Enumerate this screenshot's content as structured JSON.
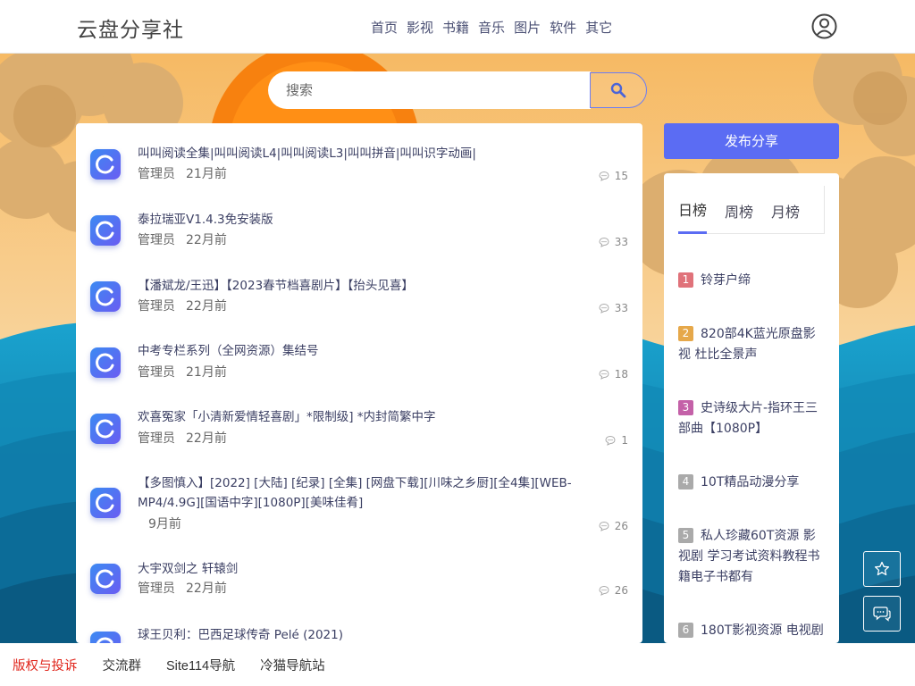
{
  "site": {
    "title": "云盘分享社"
  },
  "nav": [
    "首页",
    "影视",
    "书籍",
    "音乐",
    "图片",
    "软件",
    "其它"
  ],
  "search": {
    "placeholder": "搜索"
  },
  "posts": [
    {
      "title": "叫叫阅读全集|叫叫阅读L4|叫叫阅读L3|叫叫拼音|叫叫识字动画|",
      "author": "管理员",
      "time": "21月前",
      "comments": "15"
    },
    {
      "title": "泰拉瑞亚V1.4.3免安装版",
      "author": "管理员",
      "time": "22月前",
      "comments": "33"
    },
    {
      "title": "【潘斌龙/王迅】【2023春节档喜剧片】【抬头见喜】",
      "author": "管理员",
      "time": "22月前",
      "comments": "33"
    },
    {
      "title": "中考专栏系列（全网资源）集结号",
      "author": "管理员",
      "time": "21月前",
      "comments": "18"
    },
    {
      "title": "欢喜冤家「小清新爱情轻喜剧」*限制级] *内封简繁中字",
      "author": "管理员",
      "time": "22月前",
      "comments": "1"
    },
    {
      "title": "【多图慎入】[2022] [大陆] [纪录] [全集] [网盘下载][川味之乡厨][全4集][WEB-MP4/4.9G][国语中字][1080P][美味佳肴]",
      "author": "",
      "time": "9月前",
      "comments": "26"
    },
    {
      "title": "大宇双剑之 轩辕剑",
      "author": "管理员",
      "time": "22月前",
      "comments": "26"
    },
    {
      "title": "球王贝利：巴西足球传奇 Pelé (2021)",
      "author": "",
      "time": "",
      "comments": ""
    }
  ],
  "sidebar": {
    "publish_label": "发布分享",
    "tabs": [
      "日榜",
      "周榜",
      "月榜"
    ],
    "ranking": [
      {
        "num": "1",
        "title": "铃芽户缔",
        "color": "#e0727a"
      },
      {
        "num": "2",
        "title": "820部4K蓝光原盘影视 杜比全景声",
        "color": "#e6a84a"
      },
      {
        "num": "3",
        "title": "史诗级大片-指环王三部曲【1080P】",
        "color": "#c461a8"
      },
      {
        "num": "4",
        "title": "10T精品动漫分享",
        "color": "#aaaaaa"
      },
      {
        "num": "5",
        "title": "私人珍藏60T资源 影视剧 学习考试资料教程书籍电子书都有",
        "color": "#aaaaaa"
      },
      {
        "num": "6",
        "title": "180T影视资源 电视剧",
        "color": "#aaaaaa"
      }
    ]
  },
  "floating": {
    "star_icon": "star-icon",
    "chat_icon": "chat-icon"
  },
  "footer": [
    "版权与投诉",
    "交流群",
    "Site114导航",
    "冷猫导航站"
  ],
  "colors": {
    "accent": "#5b6cf3",
    "footer_highlight": "#e0251b"
  }
}
